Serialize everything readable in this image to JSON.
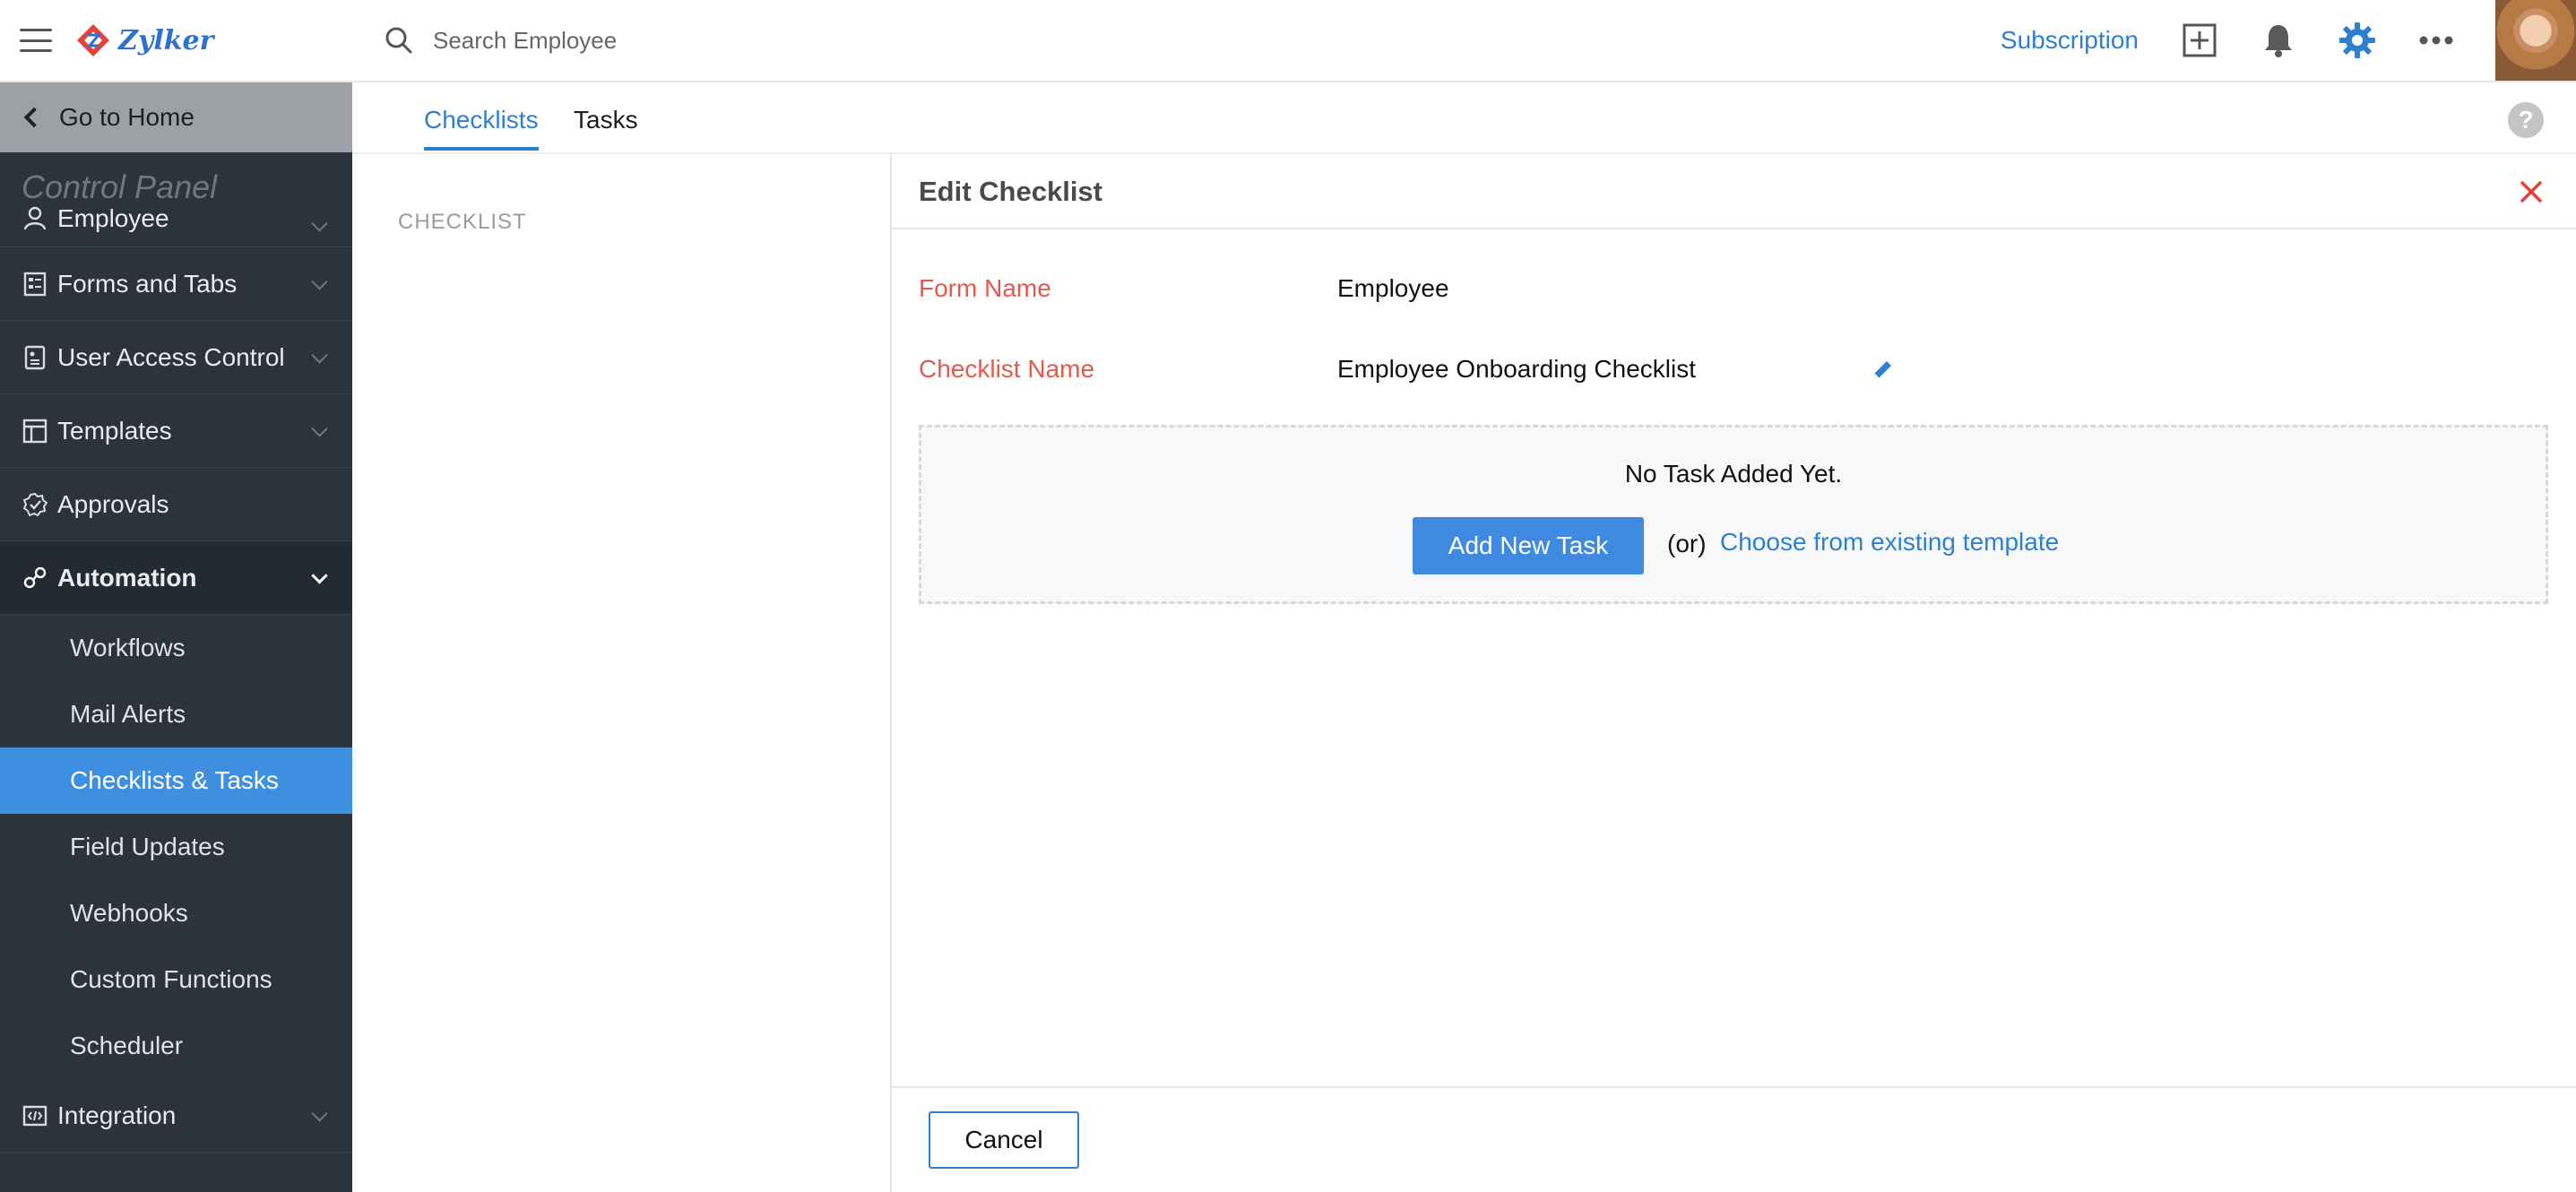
{
  "app": {
    "brand": "Zylker"
  },
  "sidebar": {
    "go_home": "Go to Home",
    "control_panel": "Control Panel",
    "items": [
      {
        "label": "Employee",
        "icon": "person-icon"
      },
      {
        "label": "Forms and Tabs",
        "icon": "form-icon"
      },
      {
        "label": "User Access Control",
        "icon": "access-icon"
      },
      {
        "label": "Templates",
        "icon": "template-icon"
      },
      {
        "label": "Approvals",
        "icon": "approval-icon"
      },
      {
        "label": "Automation",
        "icon": "automation-icon"
      },
      {
        "label": "Integration",
        "icon": "integration-icon"
      }
    ],
    "automation_sub": [
      "Workflows",
      "Mail Alerts",
      "Checklists & Tasks",
      "Field Updates",
      "Webhooks",
      "Custom Functions",
      "Scheduler"
    ],
    "selected_sub": "Checklists & Tasks"
  },
  "topbar": {
    "search_placeholder": "Search Employee",
    "subscription": "Subscription",
    "icons": [
      "add-icon",
      "bell-icon",
      "gear-icon",
      "more-icon"
    ]
  },
  "tabs": [
    {
      "label": "Checklists",
      "active": true
    },
    {
      "label": "Tasks",
      "active": false
    }
  ],
  "checklist_column": {
    "label": "CHECKLIST"
  },
  "edit_panel": {
    "title": "Edit Checklist",
    "form_name_label": "Form Name",
    "form_name_value": "Employee",
    "checklist_name_label": "Checklist Name",
    "checklist_name_value": "Employee Onboarding Checklist",
    "empty_message": "No Task Added Yet.",
    "add_button": "Add New Task",
    "or_text": "(or)",
    "template_link": "Choose from existing template",
    "cancel_button": "Cancel"
  },
  "colors": {
    "accent": "#2f7fd1",
    "sidebar_bg": "#2c333c",
    "selected_bg": "#3f8fe0",
    "label_red": "#e35a4c",
    "button_blue": "#3f8ae0"
  }
}
